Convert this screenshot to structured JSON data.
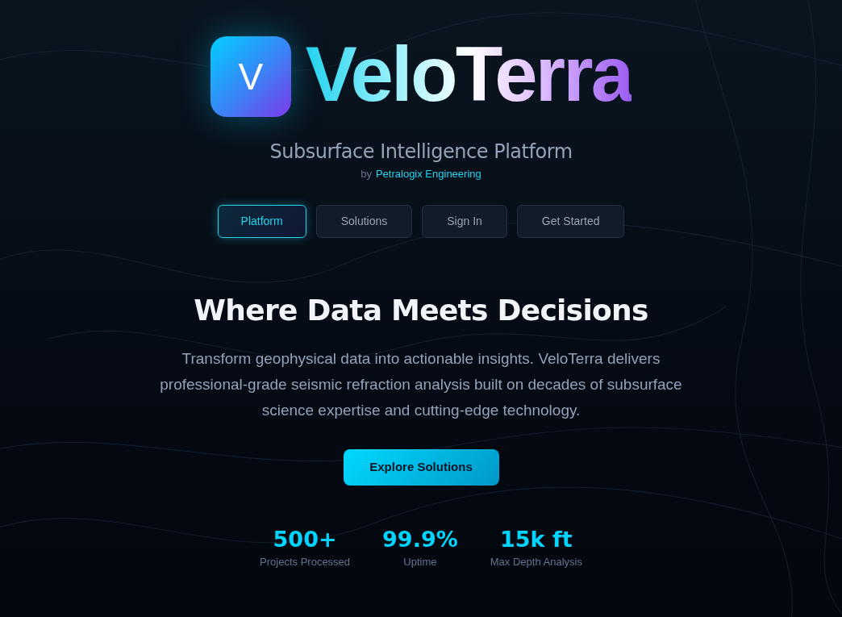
{
  "logo": {
    "letter": "V",
    "wordmark": "VeloTerra"
  },
  "tagline": "Subsurface Intelligence Platform",
  "byline": {
    "prefix": "by",
    "company": "Petralogix Engineering"
  },
  "nav": [
    {
      "label": "Platform",
      "selected": true
    },
    {
      "label": "Solutions",
      "selected": false
    },
    {
      "label": "Sign In",
      "selected": false
    },
    {
      "label": "Get Started",
      "selected": false
    }
  ],
  "hero": {
    "heading": "Where Data Meets Decisions",
    "description": "Transform geophysical data into actionable insights. VeloTerra delivers professional-grade seismic refraction analysis built on decades of subsurface science expertise and cutting-edge technology.",
    "cta": "Explore Solutions"
  },
  "stats": [
    {
      "value": "500+",
      "label": "Projects Processed"
    },
    {
      "value": "99.9%",
      "label": "Uptime"
    },
    {
      "value": "15k ft",
      "label": "Max Depth Analysis"
    }
  ]
}
